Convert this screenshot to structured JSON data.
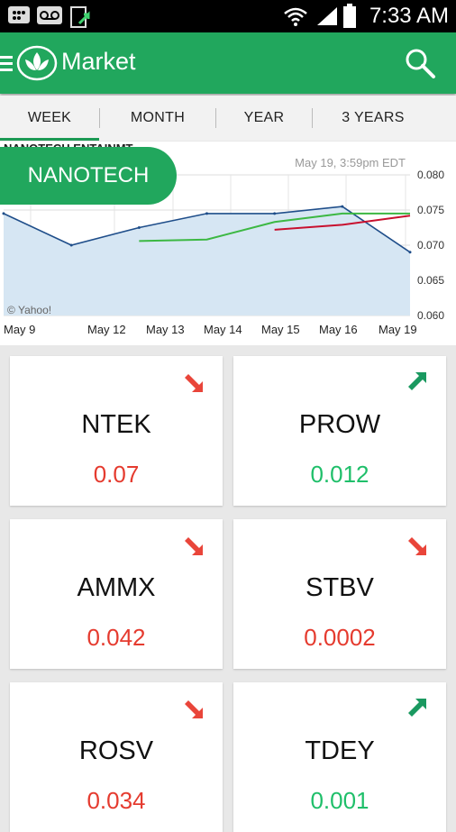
{
  "status_bar": {
    "time": "7:33 AM",
    "icons": [
      "bbm-icon",
      "voicemail-icon",
      "download-icon",
      "wifi-icon",
      "signal-icon",
      "battery-icon"
    ]
  },
  "app_bar": {
    "title": "Market",
    "menu_icon": "menu-icon",
    "logo_icon": "leaf-logo-icon",
    "search_icon": "search-icon"
  },
  "tabs": [
    "WEEK",
    "MONTH",
    "YEAR",
    "3 YEARS"
  ],
  "active_tab": "WEEK",
  "chart": {
    "pill_label": "NANOTECH",
    "title": "NANOTECH ENTAINMT",
    "timestamp": "May 19, 3:59pm EDT",
    "watermark": "© Yahoo!",
    "x_labels": [
      "May 9",
      "May 12",
      "May 13",
      "May 14",
      "May 15",
      "May 16",
      "May 19"
    ],
    "y_labels": [
      "0.080",
      "0.075",
      "0.070",
      "0.065",
      "0.060"
    ]
  },
  "chart_data": {
    "type": "area",
    "title": "NANOTECH ENTAINMT",
    "ylim": [
      0.06,
      0.08
    ],
    "x": [
      "May 9",
      "May 12",
      "May 13",
      "May 14",
      "May 15",
      "May 16",
      "May 19"
    ],
    "series": [
      {
        "values": [
          0.0745,
          0.07,
          0.0725,
          0.0745,
          0.0745,
          0.0755,
          0.069
        ]
      },
      {
        "values": [
          null,
          null,
          0.0706,
          0.0708,
          0.0733,
          0.0745,
          0.0745
        ]
      },
      {
        "values": [
          null,
          null,
          null,
          null,
          0.0722,
          0.0729,
          0.0742
        ]
      }
    ],
    "grid": true
  },
  "stocks": [
    {
      "symbol": "NTEK",
      "value": "0.07",
      "direction": "down"
    },
    {
      "symbol": "PROW",
      "value": "0.012",
      "direction": "up"
    },
    {
      "symbol": "AMMX",
      "value": "0.042",
      "direction": "down"
    },
    {
      "symbol": "STBV",
      "value": "0.0002",
      "direction": "down"
    },
    {
      "symbol": "ROSV",
      "value": "0.034",
      "direction": "down"
    },
    {
      "symbol": "TDEY",
      "value": "0.001",
      "direction": "up"
    }
  ],
  "colors": {
    "accent": "#21a75d",
    "down": "#e53b2f",
    "up": "#1fbf6a",
    "down_arrow": "#e9453a",
    "up_arrow": "#1a9960"
  }
}
